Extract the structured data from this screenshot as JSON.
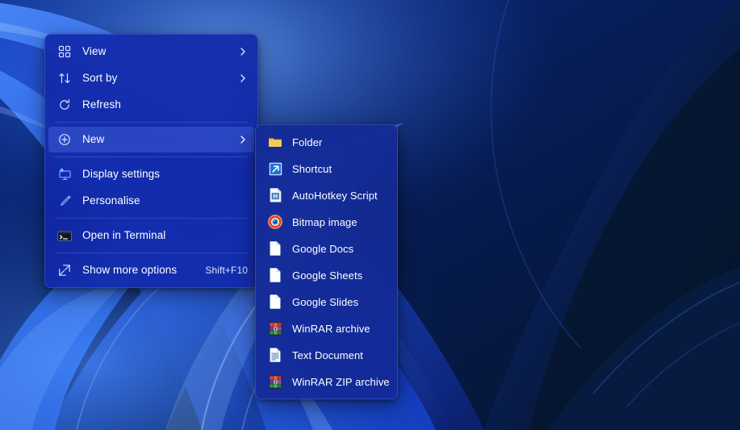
{
  "desktop": {
    "wallpaper_name": "windows-11-bloom-blue",
    "colors": {
      "background_dark": "#04152e",
      "ribbon_bright": "#2b6bff",
      "ribbon_mid": "#1a46d8",
      "ribbon_deep": "#0a1f66",
      "highlight": "#6ea2ff"
    }
  },
  "context_menu": {
    "name": "desktop-context-menu",
    "surface_color": "#1128a8",
    "items": [
      {
        "label": "View",
        "icon": "view-grid-icon",
        "has_submenu": true,
        "accel": "",
        "separator_after": false,
        "highlight": false
      },
      {
        "label": "Sort by",
        "icon": "sort-arrows-icon",
        "has_submenu": true,
        "accel": "",
        "separator_after": false,
        "highlight": false
      },
      {
        "label": "Refresh",
        "icon": "refresh-icon",
        "has_submenu": false,
        "accel": "",
        "separator_after": true,
        "highlight": false
      },
      {
        "label": "New",
        "icon": "plus-circle-icon",
        "has_submenu": true,
        "accel": "",
        "separator_after": true,
        "highlight": true
      },
      {
        "label": "Display settings",
        "icon": "monitor-gear-icon",
        "has_submenu": false,
        "accel": "",
        "separator_after": false,
        "highlight": false
      },
      {
        "label": "Personalise",
        "icon": "paintbrush-icon",
        "has_submenu": false,
        "accel": "",
        "separator_after": true,
        "highlight": false
      },
      {
        "label": "Open in Terminal",
        "icon": "terminal-icon",
        "has_submenu": false,
        "accel": "",
        "separator_after": true,
        "highlight": false
      },
      {
        "label": "Show more options",
        "icon": "expand-arrows-icon",
        "has_submenu": false,
        "accel": "Shift+F10",
        "separator_after": false,
        "highlight": false
      }
    ]
  },
  "new_submenu": {
    "name": "new-submenu",
    "parent_item": "New",
    "items": [
      {
        "label": "Folder",
        "icon": "folder-icon"
      },
      {
        "label": "Shortcut",
        "icon": "shortcut-arrow-icon"
      },
      {
        "label": "AutoHotkey Script",
        "icon": "autohotkey-script-icon"
      },
      {
        "label": "Bitmap image",
        "icon": "bitmap-image-icon"
      },
      {
        "label": "Google Docs",
        "icon": "blank-page-icon"
      },
      {
        "label": "Google Sheets",
        "icon": "blank-page-icon"
      },
      {
        "label": "Google Slides",
        "icon": "blank-page-icon"
      },
      {
        "label": "WinRAR archive",
        "icon": "winrar-archive-icon"
      },
      {
        "label": "Text Document",
        "icon": "text-document-icon"
      },
      {
        "label": "WinRAR ZIP archive",
        "icon": "winrar-zip-archive-icon"
      }
    ]
  }
}
